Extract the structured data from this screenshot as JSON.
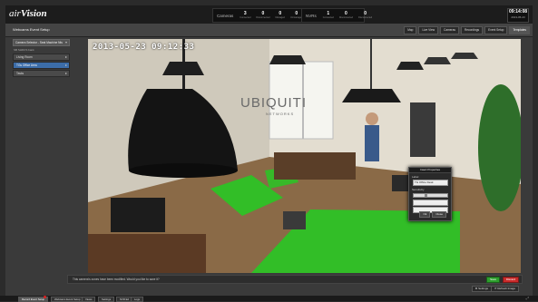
{
  "app": {
    "logo_air": "air",
    "logo_vision": "Vision"
  },
  "cameras": {
    "title": "Cameras",
    "stats": [
      {
        "value": "3",
        "label": "Connected"
      },
      {
        "value": "0",
        "label": "Disconnected"
      },
      {
        "value": "0",
        "label": "Managed"
      },
      {
        "value": "0",
        "label": "Unmanaged"
      }
    ]
  },
  "nvrs": {
    "title": "NVRs",
    "stats": [
      {
        "value": "1",
        "label": "Connected"
      },
      {
        "value": "0",
        "label": "Disconnected"
      },
      {
        "value": "0",
        "label": "Disconnected"
      }
    ]
  },
  "clock": {
    "time": "09:14:08",
    "date": "2013-05-23"
  },
  "view": {
    "title": "Webcams Event Setup"
  },
  "tabs": [
    "Map",
    "Live View",
    "Cameras",
    "Recordings",
    "Event Setup",
    "Templates"
  ],
  "sidebar": {
    "select": "Camera Selector - Seat Machine Nts",
    "subtitle": "SB SHDCS bank",
    "items": [
      "Living Room",
      "TGs Office Area",
      "Tasks"
    ],
    "selected_index": 1
  },
  "video": {
    "timestamp": "2013-05-23 09:12:33",
    "watermark": "UBIQUITI",
    "watermark_sub": "NETWORKS"
  },
  "dialog": {
    "title": "Insert Properties",
    "label_field": "Label",
    "label_value": "TG Office Desk",
    "sensitivity_label": "Sensitivity",
    "sensitivity_value": 0.35,
    "ok": "Ok",
    "cancel": "Close"
  },
  "message": {
    "text": "This camera's zones have been modified. Would you like to save it?",
    "save": "Save",
    "discard": "Discard"
  },
  "settings": {
    "settings": "Settings",
    "refresh": "Refresh Image"
  },
  "bottom_tabs": [
    "Record Event Setup",
    "Webcams Event Setup",
    "Views",
    "Settings",
    "NVR Ed",
    "Logs"
  ],
  "colors": {
    "zone": "#22cc22",
    "save": "#2d9e2d",
    "discard": "#c92a2a",
    "selected": "#3c6da8"
  }
}
